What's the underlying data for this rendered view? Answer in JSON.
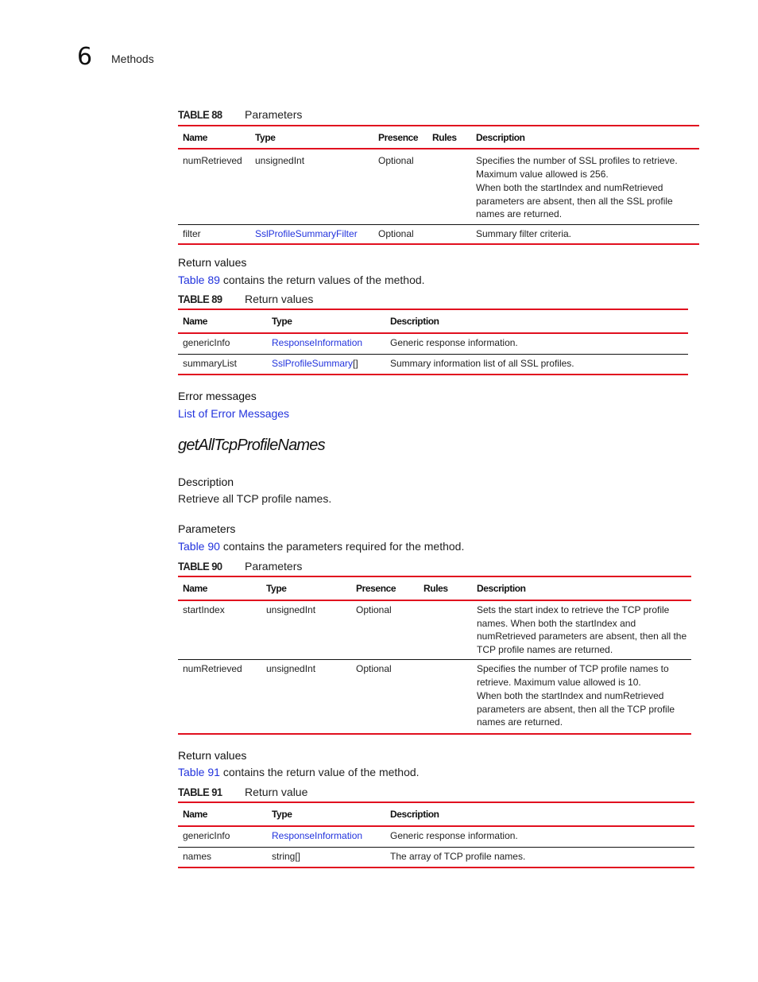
{
  "header": {
    "chapter_number": "6",
    "chapter_title": "Methods"
  },
  "table88": {
    "label": "TABLE 88",
    "caption": "Parameters",
    "columns": [
      "Name",
      "Type",
      "Presence",
      "Rules",
      "Description"
    ],
    "rows": [
      {
        "name": "numRetrieved",
        "type": "unsignedInt",
        "type_link": false,
        "presence": "Optional",
        "rules": "",
        "description": [
          "Specifies the number of SSL profiles to retrieve. Maximum value allowed is 256.",
          "When both the startIndex and numRetrieved parameters are absent, then all the SSL profile names are returned."
        ]
      },
      {
        "name": "filter",
        "type": "SslProfileSummaryFilter",
        "type_link": true,
        "presence": "Optional",
        "rules": "",
        "description": [
          "Summary filter criteria."
        ]
      }
    ]
  },
  "return_values_1": {
    "heading": "Return values",
    "link_text": "Table 89",
    "text": " contains the return values of the method."
  },
  "table89": {
    "label": "TABLE 89",
    "caption": "Return values",
    "columns": [
      "Name",
      "Type",
      "Description"
    ],
    "rows": [
      {
        "name": "genericInfo",
        "type_link_text": "ResponseInformation",
        "type_suffix": "",
        "description": "Generic response information."
      },
      {
        "name": "summaryList",
        "type_link_text": "SslProfileSummary",
        "type_suffix": "[]",
        "description": "Summary information list of all SSL profiles."
      }
    ]
  },
  "error_messages": {
    "heading": "Error messages",
    "link_text": "List of Error Messages"
  },
  "method": {
    "title": "getAllTcpProfileNames",
    "description_heading": "Description",
    "description_text": "Retrieve all TCP profile names.",
    "parameters_heading": "Parameters",
    "parameters_link_text": "Table 90",
    "parameters_text": " contains the parameters required for the method."
  },
  "table90": {
    "label": "TABLE 90",
    "caption": "Parameters",
    "columns": [
      "Name",
      "Type",
      "Presence",
      "Rules",
      "Description"
    ],
    "rows": [
      {
        "name": "startIndex",
        "type": "unsignedInt",
        "presence": "Optional",
        "rules": "",
        "description": [
          "Sets the start index to retrieve the TCP profile names. When both the startIndex and numRetrieved parameters are absent, then all the TCP profile names are returned."
        ]
      },
      {
        "name": "numRetrieved",
        "type": "unsignedInt",
        "presence": "Optional",
        "rules": "",
        "description": [
          "Specifies the number of TCP profile names to retrieve. Maximum value allowed is 10.",
          "When both the startIndex and numRetrieved parameters are absent, then all the TCP profile names are returned."
        ]
      }
    ]
  },
  "return_values_2": {
    "heading": "Return values",
    "link_text": "Table 91",
    "text": " contains the return value of the method."
  },
  "table91": {
    "label": "TABLE 91",
    "caption": "Return value",
    "columns": [
      "Name",
      "Type",
      "Description"
    ],
    "rows": [
      {
        "name": "genericInfo",
        "type_link_text": "ResponseInformation",
        "type_plain": "",
        "description": "Generic response information."
      },
      {
        "name": "names",
        "type_link_text": "",
        "type_plain": "string[]",
        "description": "The array of TCP profile names."
      }
    ]
  }
}
